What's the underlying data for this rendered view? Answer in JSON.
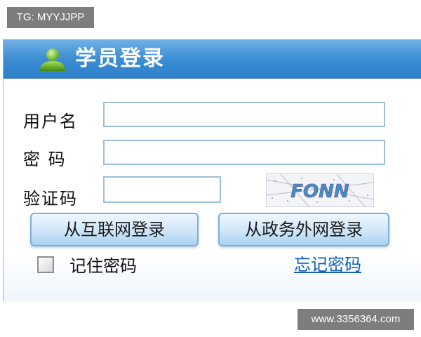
{
  "watermark_top": "TG: MYYJJPP",
  "watermark_bottom": "www.3356364.com",
  "login": {
    "title": "学员登录",
    "title_icon": "user-icon",
    "username_label": "用户名",
    "username_value": "",
    "password_label": "密 码",
    "password_value": "",
    "captcha_label": "验证码",
    "captcha_value": "",
    "captcha_text": "FONN",
    "internet_login_label": "从互联网登录",
    "gov_login_label": "从政务外网登录",
    "remember_label": "记住密码",
    "remember_checked": false,
    "forgot_label": "忘记密码"
  },
  "colors": {
    "title_bar": "#3e8fd4",
    "link": "#1560b5",
    "button_border": "#7fb0d8"
  }
}
